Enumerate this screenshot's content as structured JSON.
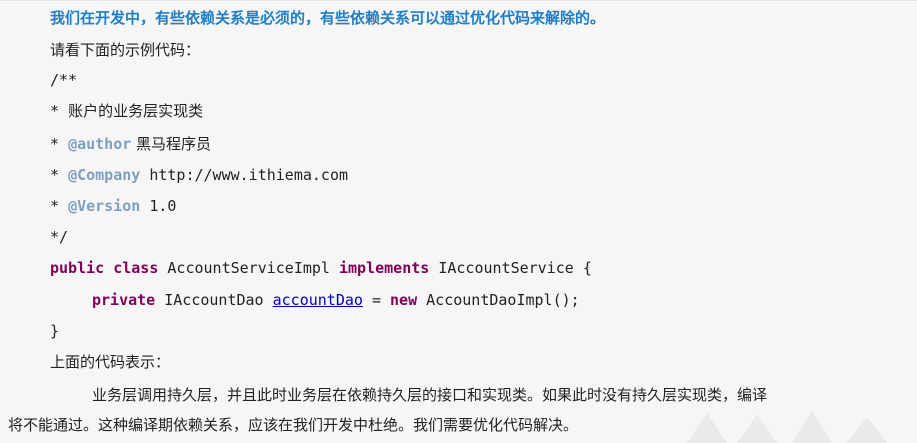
{
  "heading": "我们在开发中，有些依赖关系是必须的，有些依赖关系可以通过优化代码来解除的。",
  "intro": "请看下面的示例代码：",
  "code": {
    "l1": "/**",
    "l2_prefix": " * ",
    "l2_text": "账户的业务层实现类",
    "l3_prefix": " * ",
    "l3_tag": "@author",
    "l3_text": " 黑马程序员",
    "l4_prefix": " * ",
    "l4_tag": "@Company",
    "l4_text": " http://www.ithiema.com",
    "l5_prefix": " * ",
    "l5_tag": "@Version",
    "l5_text": " 1.0",
    "l6": " */",
    "l7_kw1": "public class",
    "l7_t1": " AccountServiceImpl ",
    "l7_kw2": "implements",
    "l7_t2": " IAccountService {",
    "l8_kw1": "private",
    "l8_t1": " IAccountDao ",
    "l8_field": "accountDao",
    "l8_t2": " = ",
    "l8_kw2": "new",
    "l8_t3": " AccountDaoImpl();",
    "l9": "}"
  },
  "explain_label": "上面的代码表示：",
  "paragraph_line1": "业务层调用持久层，并且此时业务层在依赖持久层的接口和实现类。如果此时没有持久层实现类，编译",
  "paragraph_line2": "将不能通过。这种编译期依赖关系，应该在我们开发中杜绝。我们需要优化代码解决。",
  "colors": {
    "heading": "#1f7ec6",
    "keyword": "#7f0055",
    "javadoc_tag": "#7f9fbf",
    "field": "#0000c0",
    "background": "#f6f6f6"
  }
}
